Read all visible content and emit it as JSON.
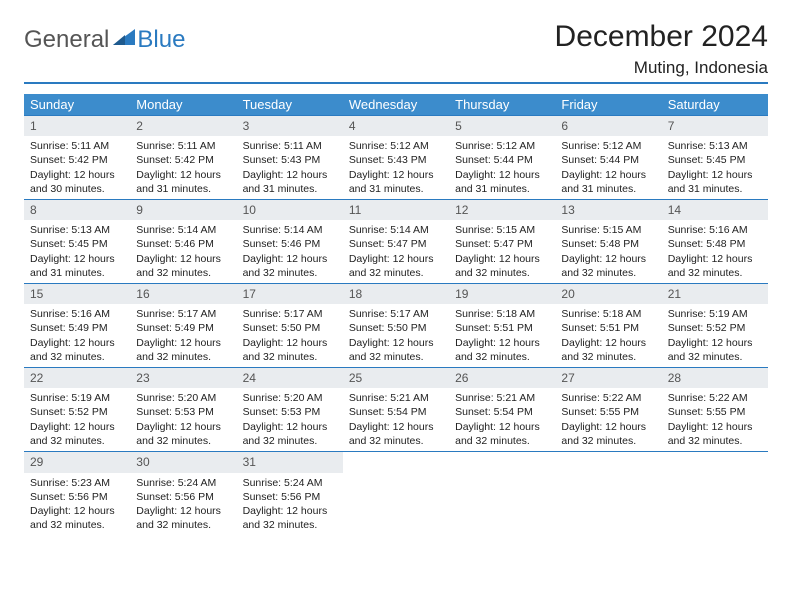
{
  "logo": {
    "part1": "General",
    "part2": "Blue"
  },
  "title": "December 2024",
  "location": "Muting, Indonesia",
  "weekdays": [
    "Sunday",
    "Monday",
    "Tuesday",
    "Wednesday",
    "Thursday",
    "Friday",
    "Saturday"
  ],
  "days": [
    {
      "n": "1",
      "sr": "5:11 AM",
      "ss": "5:42 PM",
      "dl": "12 hours and 30 minutes."
    },
    {
      "n": "2",
      "sr": "5:11 AM",
      "ss": "5:42 PM",
      "dl": "12 hours and 31 minutes."
    },
    {
      "n": "3",
      "sr": "5:11 AM",
      "ss": "5:43 PM",
      "dl": "12 hours and 31 minutes."
    },
    {
      "n": "4",
      "sr": "5:12 AM",
      "ss": "5:43 PM",
      "dl": "12 hours and 31 minutes."
    },
    {
      "n": "5",
      "sr": "5:12 AM",
      "ss": "5:44 PM",
      "dl": "12 hours and 31 minutes."
    },
    {
      "n": "6",
      "sr": "5:12 AM",
      "ss": "5:44 PM",
      "dl": "12 hours and 31 minutes."
    },
    {
      "n": "7",
      "sr": "5:13 AM",
      "ss": "5:45 PM",
      "dl": "12 hours and 31 minutes."
    },
    {
      "n": "8",
      "sr": "5:13 AM",
      "ss": "5:45 PM",
      "dl": "12 hours and 31 minutes."
    },
    {
      "n": "9",
      "sr": "5:14 AM",
      "ss": "5:46 PM",
      "dl": "12 hours and 32 minutes."
    },
    {
      "n": "10",
      "sr": "5:14 AM",
      "ss": "5:46 PM",
      "dl": "12 hours and 32 minutes."
    },
    {
      "n": "11",
      "sr": "5:14 AM",
      "ss": "5:47 PM",
      "dl": "12 hours and 32 minutes."
    },
    {
      "n": "12",
      "sr": "5:15 AM",
      "ss": "5:47 PM",
      "dl": "12 hours and 32 minutes."
    },
    {
      "n": "13",
      "sr": "5:15 AM",
      "ss": "5:48 PM",
      "dl": "12 hours and 32 minutes."
    },
    {
      "n": "14",
      "sr": "5:16 AM",
      "ss": "5:48 PM",
      "dl": "12 hours and 32 minutes."
    },
    {
      "n": "15",
      "sr": "5:16 AM",
      "ss": "5:49 PM",
      "dl": "12 hours and 32 minutes."
    },
    {
      "n": "16",
      "sr": "5:17 AM",
      "ss": "5:49 PM",
      "dl": "12 hours and 32 minutes."
    },
    {
      "n": "17",
      "sr": "5:17 AM",
      "ss": "5:50 PM",
      "dl": "12 hours and 32 minutes."
    },
    {
      "n": "18",
      "sr": "5:17 AM",
      "ss": "5:50 PM",
      "dl": "12 hours and 32 minutes."
    },
    {
      "n": "19",
      "sr": "5:18 AM",
      "ss": "5:51 PM",
      "dl": "12 hours and 32 minutes."
    },
    {
      "n": "20",
      "sr": "5:18 AM",
      "ss": "5:51 PM",
      "dl": "12 hours and 32 minutes."
    },
    {
      "n": "21",
      "sr": "5:19 AM",
      "ss": "5:52 PM",
      "dl": "12 hours and 32 minutes."
    },
    {
      "n": "22",
      "sr": "5:19 AM",
      "ss": "5:52 PM",
      "dl": "12 hours and 32 minutes."
    },
    {
      "n": "23",
      "sr": "5:20 AM",
      "ss": "5:53 PM",
      "dl": "12 hours and 32 minutes."
    },
    {
      "n": "24",
      "sr": "5:20 AM",
      "ss": "5:53 PM",
      "dl": "12 hours and 32 minutes."
    },
    {
      "n": "25",
      "sr": "5:21 AM",
      "ss": "5:54 PM",
      "dl": "12 hours and 32 minutes."
    },
    {
      "n": "26",
      "sr": "5:21 AM",
      "ss": "5:54 PM",
      "dl": "12 hours and 32 minutes."
    },
    {
      "n": "27",
      "sr": "5:22 AM",
      "ss": "5:55 PM",
      "dl": "12 hours and 32 minutes."
    },
    {
      "n": "28",
      "sr": "5:22 AM",
      "ss": "5:55 PM",
      "dl": "12 hours and 32 minutes."
    },
    {
      "n": "29",
      "sr": "5:23 AM",
      "ss": "5:56 PM",
      "dl": "12 hours and 32 minutes."
    },
    {
      "n": "30",
      "sr": "5:24 AM",
      "ss": "5:56 PM",
      "dl": "12 hours and 32 minutes."
    },
    {
      "n": "31",
      "sr": "5:24 AM",
      "ss": "5:56 PM",
      "dl": "12 hours and 32 minutes."
    }
  ],
  "labels": {
    "sunrise": "Sunrise: ",
    "sunset": "Sunset: ",
    "daylight": "Daylight: "
  },
  "start_weekday": 0,
  "total_cells": 35
}
